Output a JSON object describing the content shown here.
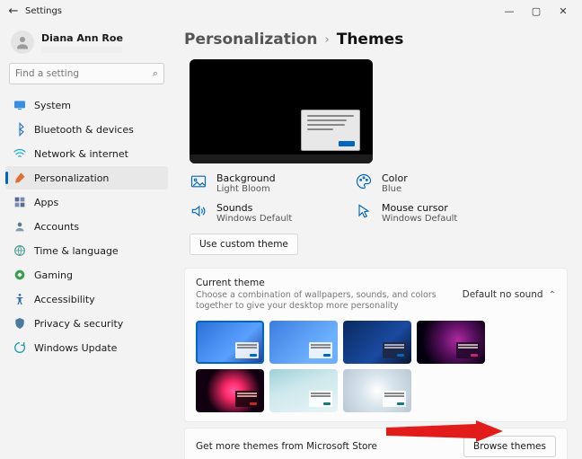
{
  "window": {
    "title": "Settings"
  },
  "user": {
    "name": "Diana Ann Roe"
  },
  "search": {
    "placeholder": "Find a setting"
  },
  "nav": [
    {
      "key": "system",
      "label": "System"
    },
    {
      "key": "bluetooth",
      "label": "Bluetooth & devices"
    },
    {
      "key": "network",
      "label": "Network & internet"
    },
    {
      "key": "personalization",
      "label": "Personalization"
    },
    {
      "key": "apps",
      "label": "Apps"
    },
    {
      "key": "accounts",
      "label": "Accounts"
    },
    {
      "key": "time",
      "label": "Time & language"
    },
    {
      "key": "gaming",
      "label": "Gaming"
    },
    {
      "key": "accessibility",
      "label": "Accessibility"
    },
    {
      "key": "privacy",
      "label": "Privacy & security"
    },
    {
      "key": "update",
      "label": "Windows Update"
    }
  ],
  "breadcrumb": {
    "level1": "Personalization",
    "level2": "Themes"
  },
  "aspects": {
    "background": {
      "label": "Background",
      "value": "Light Bloom"
    },
    "color": {
      "label": "Color",
      "value": "Blue"
    },
    "sounds": {
      "label": "Sounds",
      "value": "Windows Default"
    },
    "cursor": {
      "label": "Mouse cursor",
      "value": "Windows Default"
    }
  },
  "use_custom_label": "Use custom theme",
  "current": {
    "title": "Current theme",
    "subtitle": "Choose a combination of wallpapers, sounds, and colors together to give your desktop more personality",
    "sound_label": "Default no sound"
  },
  "store": {
    "text": "Get more themes from Microsoft Store",
    "button": "Browse themes"
  }
}
